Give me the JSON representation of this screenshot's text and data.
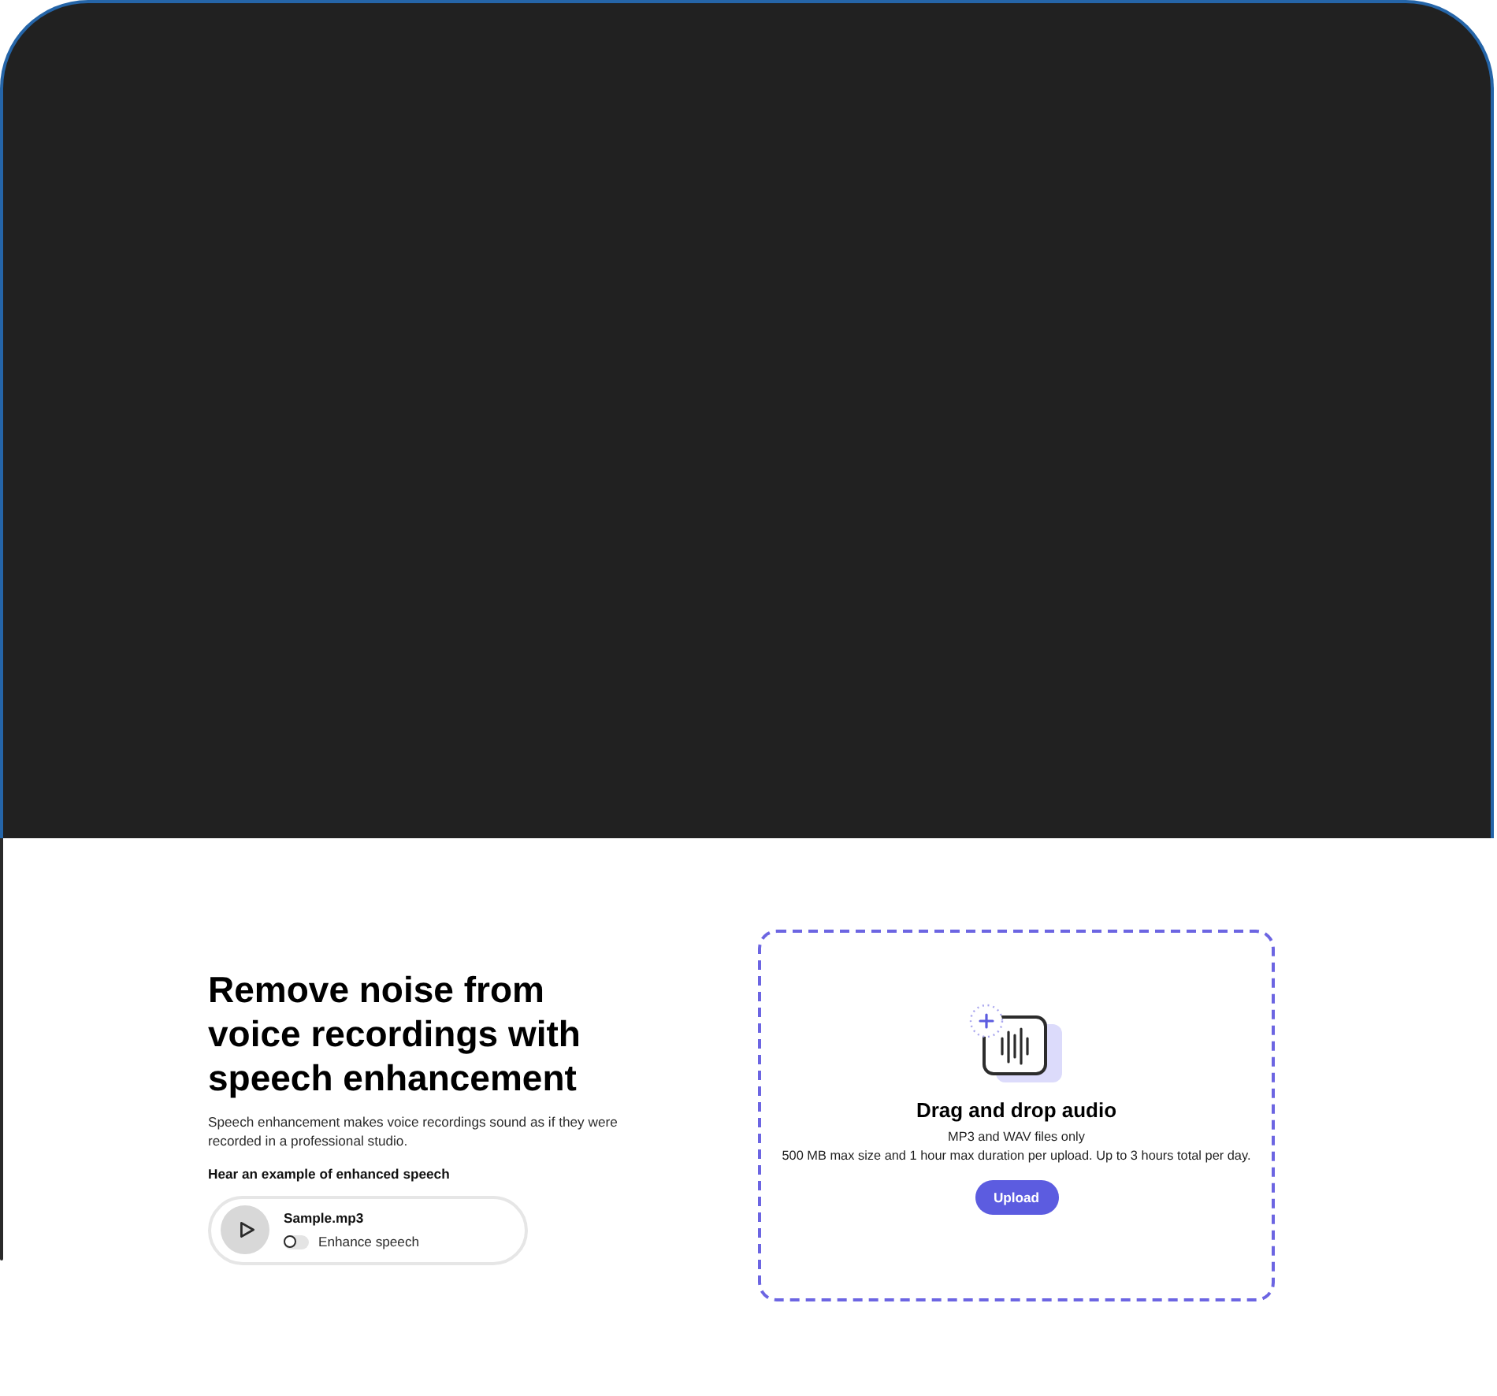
{
  "intro": {
    "heading": "Remove noise from voice recordings with speech enhancement",
    "description": "Speech enhancement makes voice recordings sound as if they were recorded in a professional studio.",
    "sample_label": "Hear an example of enhanced speech"
  },
  "sample_player": {
    "file_name": "Sample.mp3",
    "toggle": {
      "label": "Enhance speech",
      "on": false
    }
  },
  "upload": {
    "title": "Drag and drop audio",
    "details": [
      "MP3 and WAV files only",
      "500 MB max size and 1 hour max duration per upload. Up to 3 hours total per day."
    ],
    "button": "Upload"
  }
}
